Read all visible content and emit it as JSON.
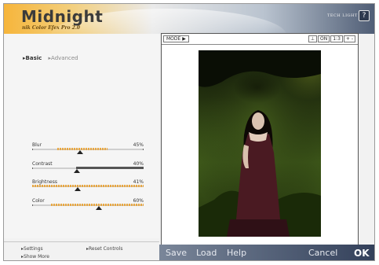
{
  "header": {
    "title": "Midnight",
    "subtitle": "nik Color Efex Pro 2.0",
    "brand": "TECH LIGHT",
    "help_label": "?"
  },
  "tabs": [
    {
      "label": "Basic",
      "active": true
    },
    {
      "label": "Advanced",
      "active": false
    }
  ],
  "sliders": [
    {
      "label": "Blur",
      "value": "45%",
      "level": 0.45
    },
    {
      "label": "Contrast",
      "value": "40%",
      "level": 0.4
    },
    {
      "label": "Brightness",
      "value": "41%",
      "level": 0.41
    },
    {
      "label": "Color",
      "value": "60%",
      "level": 0.6
    }
  ],
  "footer": {
    "settings": "Settings",
    "reset": "Reset Controls",
    "show_more": "Show More"
  },
  "preview": {
    "mode": "MODE",
    "zoom_on": "ON",
    "zoom": "1:3",
    "zoom_minus": "+ -",
    "toggle": "⊥"
  },
  "actions": {
    "save": "Save",
    "load": "Load",
    "help": "Help",
    "cancel": "Cancel",
    "ok": "OK"
  },
  "colors": {
    "slider_fill": "#e9a740",
    "header_accent": "#f6b53b"
  }
}
